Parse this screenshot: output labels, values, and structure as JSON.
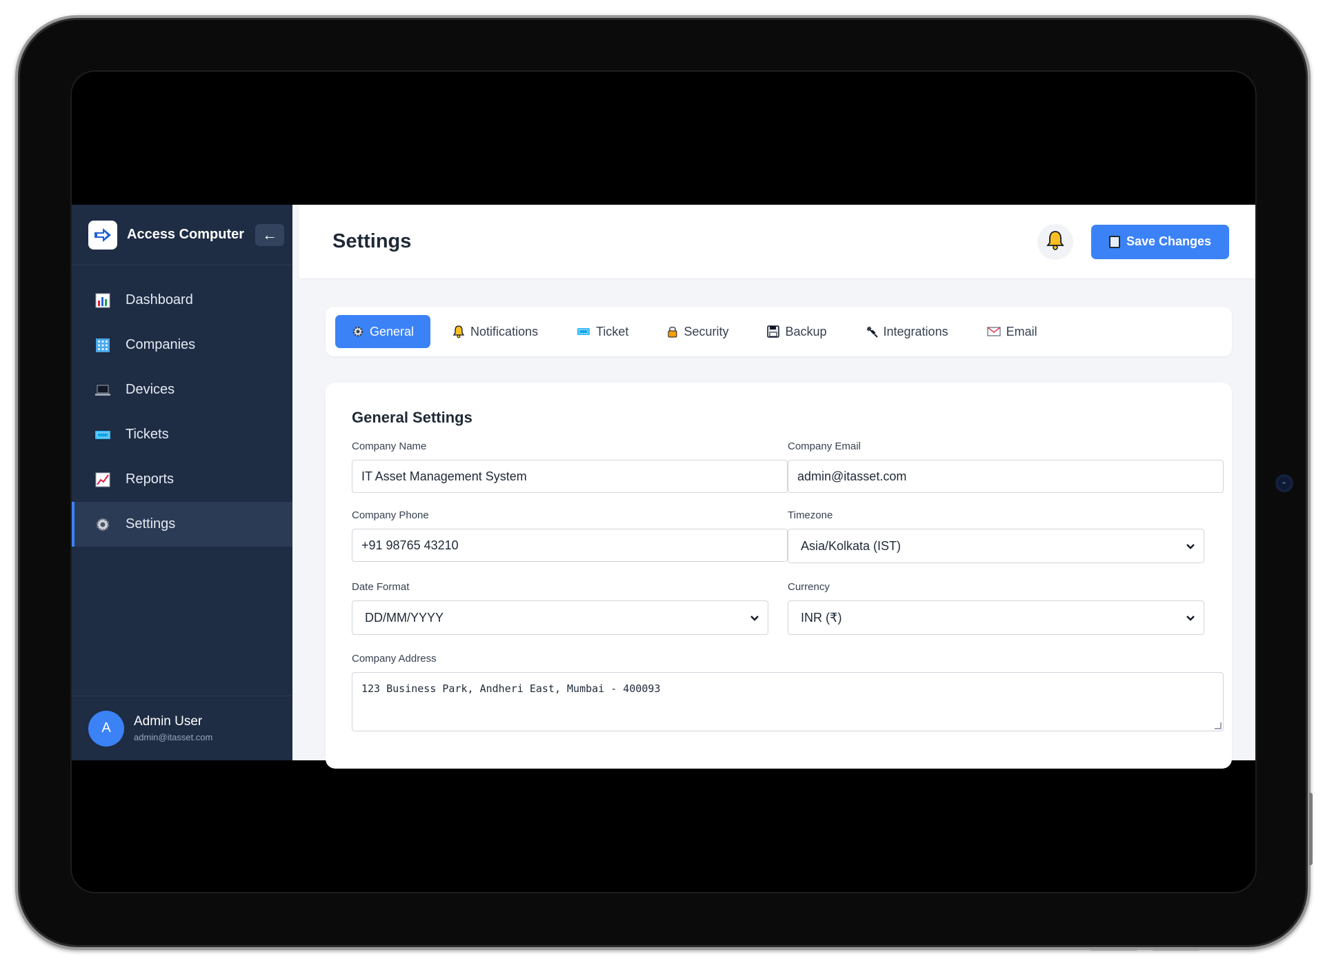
{
  "sidebar": {
    "brand": "Access Computer",
    "collapse_label": "←",
    "items": [
      {
        "label": "Dashboard",
        "icon": "bar-chart-icon"
      },
      {
        "label": "Companies",
        "icon": "building-icon"
      },
      {
        "label": "Devices",
        "icon": "laptop-icon"
      },
      {
        "label": "Tickets",
        "icon": "ticket-icon"
      },
      {
        "label": "Reports",
        "icon": "trend-chart-icon"
      },
      {
        "label": "Settings",
        "icon": "gear-icon",
        "active": true
      }
    ],
    "user": {
      "initial": "A",
      "name": "Admin User",
      "email": "admin@itasset.com"
    }
  },
  "header": {
    "title": "Settings",
    "save_label": "Save Changes"
  },
  "tabs": [
    {
      "label": "General",
      "icon": "gear-icon",
      "active": true
    },
    {
      "label": "Notifications",
      "icon": "bell-icon"
    },
    {
      "label": "Ticket",
      "icon": "ticket-icon"
    },
    {
      "label": "Security",
      "icon": "lock-icon"
    },
    {
      "label": "Backup",
      "icon": "floppy-icon"
    },
    {
      "label": "Integrations",
      "icon": "plug-icon"
    },
    {
      "label": "Email",
      "icon": "envelope-icon"
    }
  ],
  "general": {
    "section_title": "General Settings",
    "company_name": {
      "label": "Company Name",
      "value": "IT Asset Management System"
    },
    "company_email": {
      "label": "Company Email",
      "value": "admin@itasset.com"
    },
    "company_phone": {
      "label": "Company Phone",
      "value": "+91 98765 43210"
    },
    "timezone": {
      "label": "Timezone",
      "value": "Asia/Kolkata (IST)"
    },
    "date_format": {
      "label": "Date Format",
      "value": "DD/MM/YYYY"
    },
    "currency": {
      "label": "Currency",
      "value": "INR (₹)"
    },
    "company_address": {
      "label": "Company Address",
      "value": "123 Business Park, Andheri East, Mumbai - 400093"
    }
  },
  "colors": {
    "accent": "#3b82f6",
    "sidebar": "#1e2c44",
    "background": "#f3f5f8"
  }
}
